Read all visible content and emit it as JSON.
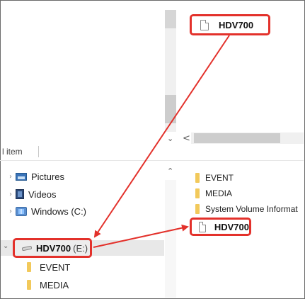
{
  "status_bar": {
    "item_count": "l item"
  },
  "nav_tree": {
    "items": [
      {
        "label": "Pictures"
      },
      {
        "label": "Videos"
      },
      {
        "label": "Windows (C:)"
      }
    ],
    "selected_drive": {
      "label": "HDV700",
      "suffix": "(E:)"
    },
    "children": [
      {
        "label": "EVENT"
      },
      {
        "label": "MEDIA"
      }
    ]
  },
  "file_list": {
    "items": [
      {
        "label": "EVENT"
      },
      {
        "label": "MEDIA"
      },
      {
        "label": "System Volume Informat"
      }
    ],
    "highlighted_file": {
      "label": "HDV700"
    }
  },
  "callout_top": {
    "label": "HDV700"
  },
  "colors": {
    "annotation": "#e3312b",
    "selection": "#e8e8e8",
    "folder": "#f2c95b"
  }
}
